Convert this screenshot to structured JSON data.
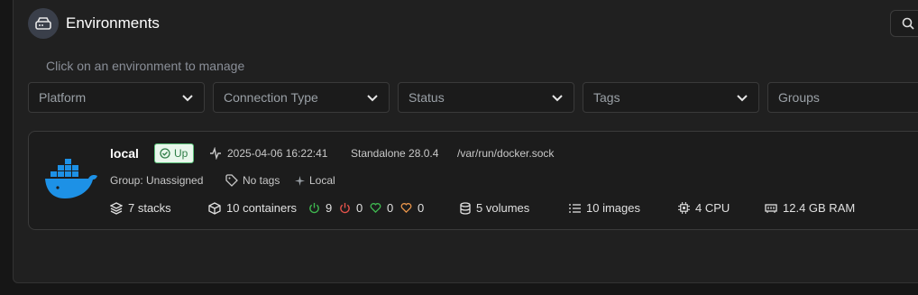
{
  "header": {
    "title": "Environments",
    "icon": "hard-drive-icon",
    "search_icon": "search-icon"
  },
  "hint": "Click on an environment to manage",
  "filters": [
    {
      "label": "Platform"
    },
    {
      "label": "Connection Type"
    },
    {
      "label": "Status"
    },
    {
      "label": "Tags"
    },
    {
      "label": "Groups"
    }
  ],
  "environment": {
    "name": "local",
    "status": "Up",
    "heartbeat": "2025-04-06 16:22:41",
    "type": "Standalone 28.0.4",
    "url": "/var/run/docker.sock",
    "group": "Group: Unassigned",
    "tags": "No tags",
    "location": "Local",
    "stacks": "7 stacks",
    "containers": "10 containers",
    "running": "9",
    "stopped": "0",
    "healthy": "0",
    "unhealthy": "0",
    "volumes": "5 volumes",
    "images": "10 images",
    "cpu": "4 CPU",
    "ram": "12.4 GB RAM"
  },
  "colors": {
    "running": "#3fb950",
    "stopped": "#e5534b",
    "healthy": "#3fb950",
    "unhealthy": "#e8944a",
    "docker": "#1d91e6"
  }
}
